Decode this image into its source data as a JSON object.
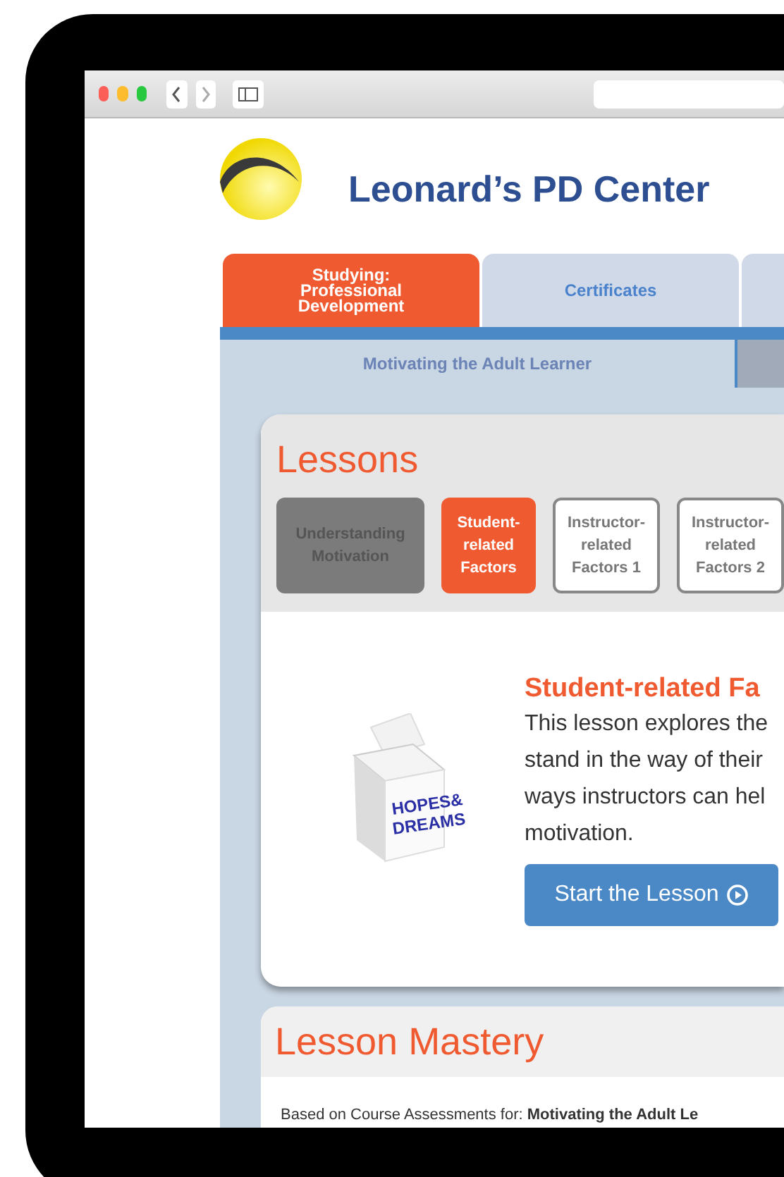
{
  "site": {
    "title": "Leonard’s PD Center"
  },
  "tabs": [
    {
      "label": "Studying:\nProfessional\nDevelopment",
      "selected": true
    },
    {
      "label": "Certificates",
      "selected": false
    }
  ],
  "subnav": [
    {
      "label": "Motivating the Adult Learner",
      "selected": true
    }
  ],
  "lessons": {
    "title": "Lessons",
    "items": [
      {
        "label": "Understanding\nMotivation",
        "completed": true,
        "selected": false
      },
      {
        "label": "Student-\nrelated\nFactors",
        "completed": false,
        "selected": true
      },
      {
        "label": "Instructor-\nrelated\nFactors 1",
        "completed": false,
        "selected": false
      },
      {
        "label": "Instructor-\nrelated\nFactors 2",
        "completed": false,
        "selected": false
      }
    ],
    "image_label": [
      "HOPES&",
      "DREAMS"
    ],
    "detail": {
      "heading": "Student-related Fa",
      "body": "This lesson explores the\nstand in the way of their\nways instructors can hel\nmotivation.",
      "button": "Start the Lesson"
    }
  },
  "mastery": {
    "title": "Lesson Mastery",
    "note": "Based on Course Assessments for: **Motivating the Adult Le**"
  }
}
